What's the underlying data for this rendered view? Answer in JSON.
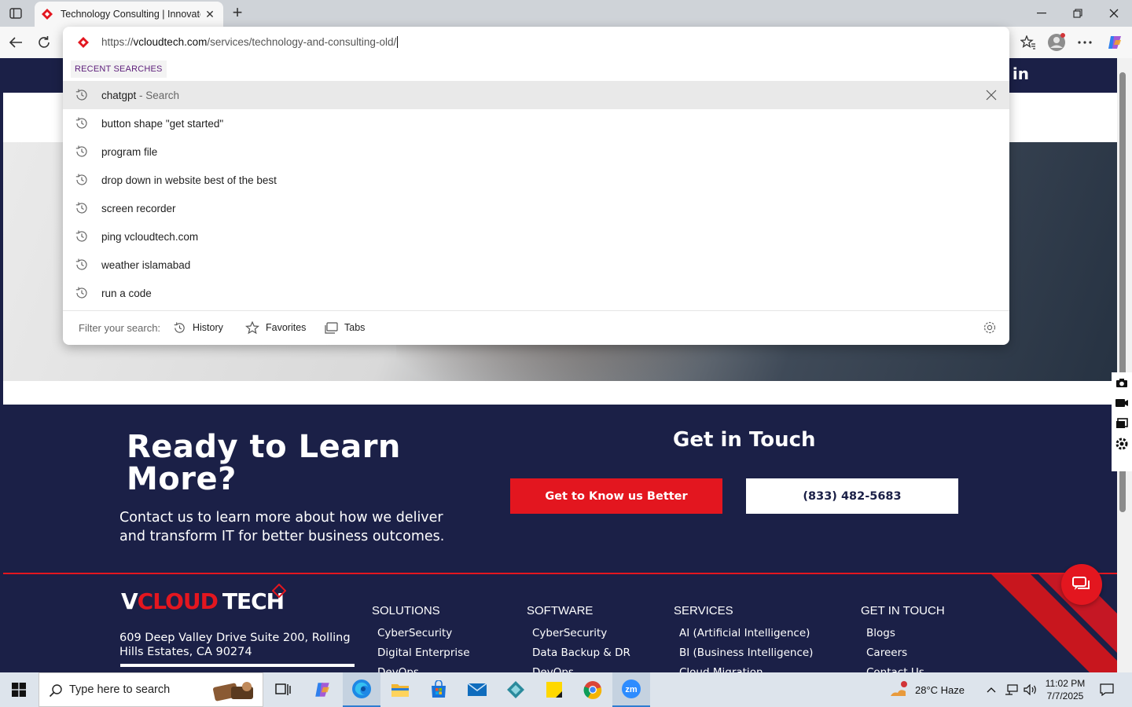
{
  "browser": {
    "tab_title": "Technology Consulting | Innovate",
    "address": {
      "prefix": "https://",
      "host": "vcloudtech.com",
      "path": "/services/technology-and-consulting-old/"
    },
    "recent_label": "RECENT SEARCHES",
    "suggestions": [
      {
        "text": "chatgpt",
        "sub": " - Search"
      },
      {
        "text": "button shape \"get started\"",
        "sub": ""
      },
      {
        "text": "program file",
        "sub": ""
      },
      {
        "text": "drop down in website best of the best",
        "sub": ""
      },
      {
        "text": "screen recorder",
        "sub": ""
      },
      {
        "text": "ping vcloudtech.com",
        "sub": ""
      },
      {
        "text": "weather islamabad",
        "sub": ""
      },
      {
        "text": "run a code",
        "sub": ""
      }
    ],
    "filter": {
      "label": "Filter your search:",
      "history": "History",
      "favorites": "Favorites",
      "tabs": "Tabs"
    }
  },
  "page": {
    "cta_title": "Ready to Learn More?",
    "cta_text": "Contact us to learn more about how we deliver and transform IT for better business outcomes.",
    "get_in_touch": "Get in Touch",
    "btn_primary": "Get to Know us Better",
    "btn_phone": "(833) 482-5683",
    "logo": {
      "v": "V",
      "cloud": "CLOUD",
      "tech": "TECH"
    },
    "address": "609 Deep Valley Drive Suite 200, Rolling Hills Estates, CA 90274",
    "footer_cols": [
      {
        "title": "SOLUTIONS",
        "items": [
          "CyberSecurity",
          "Digital Enterprise",
          "DevOps"
        ]
      },
      {
        "title": "SOFTWARE",
        "items": [
          "CyberSecurity",
          "Data Backup & DR",
          "DevOps"
        ]
      },
      {
        "title": "SERVICES",
        "items": [
          "AI (Artificial Intelligence)",
          "BI (Business Intelligence)",
          "Cloud Migration"
        ]
      },
      {
        "title": "GET IN TOUCH",
        "items": [
          "Blogs",
          "Careers",
          "Contact Us"
        ]
      }
    ],
    "brand_colors": {
      "navy": "#1b2047",
      "red": "#e3161f"
    }
  },
  "taskbar": {
    "search_placeholder": "Type here to search",
    "weather": "28°C  Haze",
    "time": "11:02 PM",
    "date": "7/7/2025"
  }
}
